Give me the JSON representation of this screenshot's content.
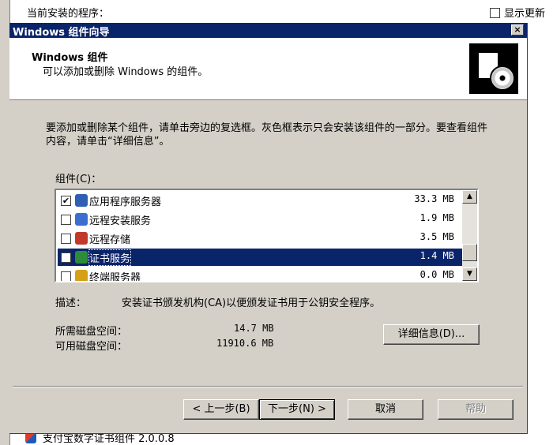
{
  "background": {
    "list_title": "当前安装的程序：",
    "show_updates_label": "显示更新",
    "bottom_item": "支付宝数字证书组件 2.0.0.8"
  },
  "dialog": {
    "title": "Windows 组件向导",
    "close_label": "×",
    "header_title": "Windows 组件",
    "header_subtitle": "可以添加或删除 Windows 的组件。",
    "instruction": "要添加或删除某个组件，请单击旁边的复选框。灰色框表示只会安装该组件的一部分。要查看组件内容，请单击“详细信息”。",
    "components_label": "组件(C)：",
    "components": [
      {
        "name": "应用程序服务器",
        "size": "33.3 MB",
        "checked": true,
        "selected": false,
        "icon": "app-server-icon"
      },
      {
        "name": "远程安装服务",
        "size": "1.9 MB",
        "checked": false,
        "selected": false,
        "icon": "remote-install-icon"
      },
      {
        "name": "远程存储",
        "size": "3.5 MB",
        "checked": false,
        "selected": false,
        "icon": "remote-storage-icon"
      },
      {
        "name": "证书服务",
        "size": "1.4 MB",
        "checked": false,
        "selected": true,
        "icon": "certificate-icon"
      },
      {
        "name": "终端服务器",
        "size": "0.0 MB",
        "checked": false,
        "selected": false,
        "icon": "terminal-server-icon"
      }
    ],
    "description_label": "描述：",
    "description": "安装证书颁发机构(CA)以便颁发证书用于公钥安全程序。",
    "required_label": "所需磁盘空间：",
    "required_value": "14.7 MB",
    "available_label": "可用磁盘空间：",
    "available_value": "11910.6 MB",
    "details_button": "详细信息(D)...",
    "back_button": "< 上一步(B)",
    "next_button": "下一步(N) >",
    "cancel_button": "取消",
    "help_button": "帮助"
  }
}
